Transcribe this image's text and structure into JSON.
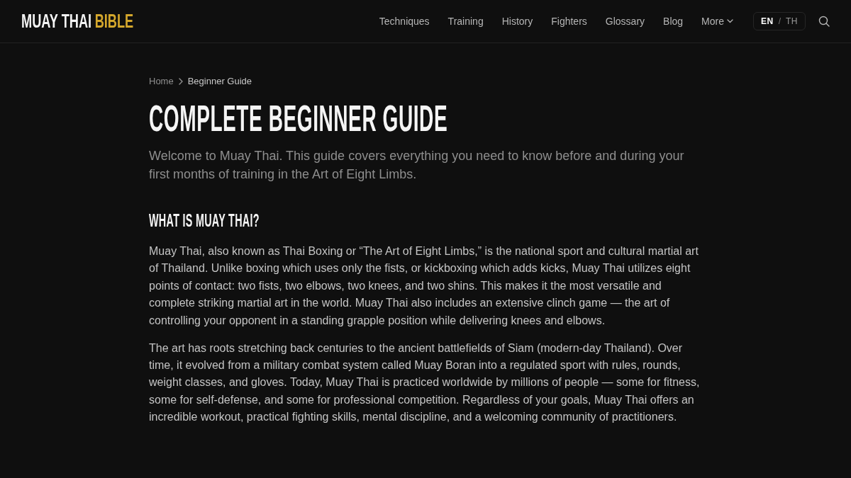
{
  "header": {
    "logo": {
      "primary": "MUAY THAI",
      "accent": "BIBLE"
    },
    "nav": [
      {
        "label": "Techniques",
        "has_menu": false
      },
      {
        "label": "Training",
        "has_menu": false
      },
      {
        "label": "History",
        "has_menu": false
      },
      {
        "label": "Fighters",
        "has_menu": false
      },
      {
        "label": "Glossary",
        "has_menu": false
      },
      {
        "label": "Blog",
        "has_menu": false
      },
      {
        "label": "More",
        "has_menu": true
      }
    ],
    "language_switch": {
      "separator": "/",
      "options": [
        {
          "label": "EN",
          "selected": true
        },
        {
          "label": "TH",
          "selected": false
        }
      ]
    }
  },
  "breadcrumb": [
    {
      "label": "Home",
      "current": false
    },
    {
      "label": "Beginner Guide",
      "current": true
    }
  ],
  "article": {
    "title": "COMPLETE BEGINNER GUIDE",
    "lead": "Welcome to Muay Thai. This guide covers everything you need to know before and during your first months of training in the Art of Eight Limbs.",
    "sections": [
      {
        "heading": "WHAT IS MUAY THAI?",
        "paragraphs": [
          "Muay Thai, also known as Thai Boxing or “The Art of Eight Limbs,” is the national sport and cultural martial art of Thailand. Unlike boxing which uses only the fists, or kickboxing which adds kicks, Muay Thai utilizes eight points of contact: two fists, two elbows, two knees, and two shins. This makes it the most versatile and complete striking martial art in the world. Muay Thai also includes an extensive clinch game — the art of controlling your opponent in a standing grapple position while delivering knees and elbows.",
          "The art has roots stretching back centuries to the ancient battlefields of Siam (modern-day Thailand). Over time, it evolved from a military combat system called Muay Boran into a regulated sport with rules, rounds, weight classes, and gloves. Today, Muay Thai is practiced worldwide by millions of people — some for fitness, some for self-defense, and some for professional competition. Regardless of your goals, Muay Thai offers an incredible workout, practical fighting skills, mental discipline, and a welcoming community of practitioners."
        ]
      }
    ]
  }
}
